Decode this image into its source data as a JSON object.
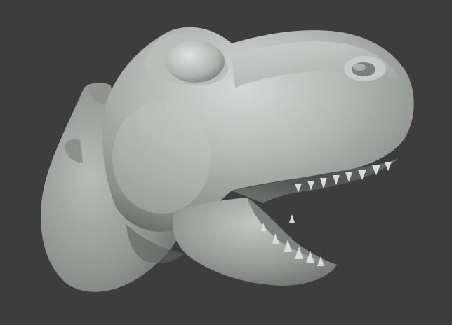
{
  "scene": {
    "background_color": "#3d3d3d",
    "material_base_color": "#a9aeab",
    "material_highlight_color": "#d6dad8",
    "material_shadow_color": "#5f6461",
    "teeth_color": "#d9dcdb",
    "subject": "sculpted-dinosaur-head",
    "shading": "matcap-clay"
  }
}
